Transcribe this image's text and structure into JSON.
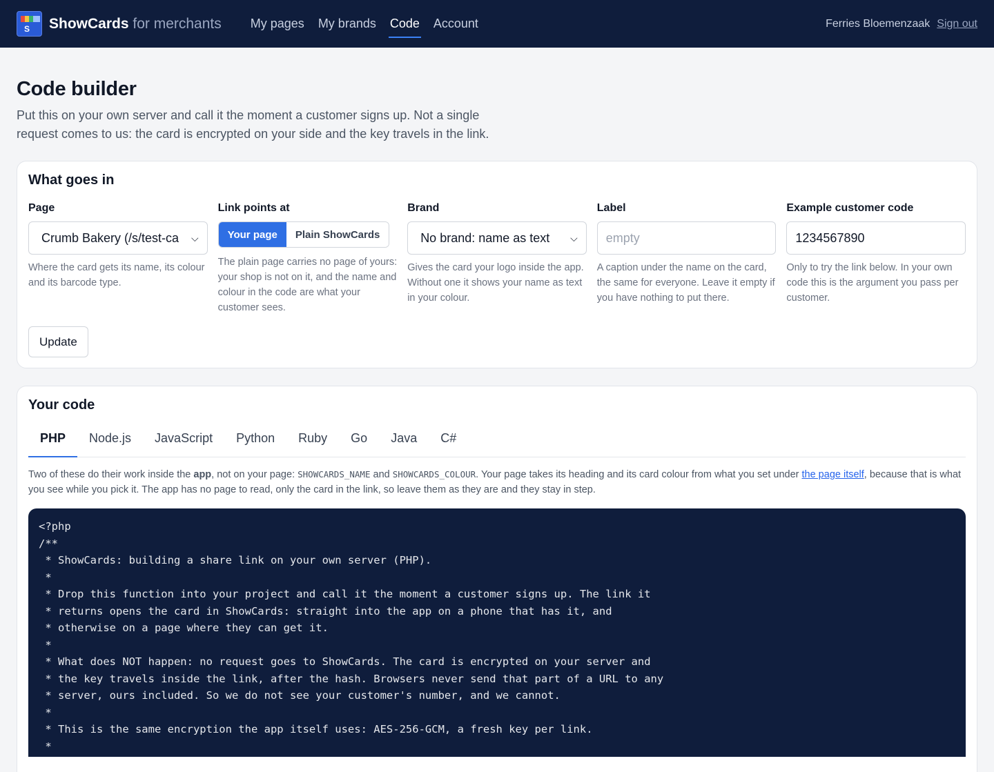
{
  "header": {
    "brand_name": "ShowCards",
    "brand_sub": "for merchants",
    "logo_letter": "S",
    "nav": [
      {
        "label": "My pages",
        "active": false
      },
      {
        "label": "My brands",
        "active": false
      },
      {
        "label": "Code",
        "active": true
      },
      {
        "label": "Account",
        "active": false
      }
    ],
    "user_name": "Ferries Bloemenzaak",
    "sign_out": "Sign out"
  },
  "page": {
    "title": "Code builder",
    "intro": "Put this on your own server and call it the moment a customer signs up. Not a single request comes to us: the card is encrypted on your side and the key travels in the link."
  },
  "inputs_card": {
    "title": "What goes in",
    "page_field": {
      "label": "Page",
      "value": "Crumb Bakery (/s/test-ca",
      "help": "Where the card gets its name, its colour and its barcode type."
    },
    "link_field": {
      "label": "Link points at",
      "options": [
        "Your page",
        "Plain ShowCards"
      ],
      "selected": "Your page",
      "help": "The plain page carries no page of yours: your shop is not on it, and the name and colour in the code are what your customer sees."
    },
    "brand_field": {
      "label": "Brand",
      "value": "No brand: name as text",
      "help": "Gives the card your logo inside the app. Without one it shows your name as text in your colour."
    },
    "label_field": {
      "label": "Label",
      "value": "",
      "placeholder": "empty",
      "help": "A caption under the name on the card, the same for everyone. Leave it empty if you have nothing to put there."
    },
    "customer_field": {
      "label": "Example customer code",
      "value": "1234567890",
      "help": "Only to try the link below. In your own code this is the argument you pass per customer."
    },
    "update_button": "Update"
  },
  "code_card": {
    "title": "Your code",
    "tabs": [
      "PHP",
      "Node.js",
      "JavaScript",
      "Python",
      "Ruby",
      "Go",
      "Java",
      "C#"
    ],
    "active_tab": "PHP",
    "note": {
      "part1": "Two of these do their work inside the ",
      "strong": "app",
      "part2": ", not on your page: ",
      "code1": "SHOWCARDS_NAME",
      "and": " and ",
      "code2": "SHOWCARDS_COLOUR",
      "part3": ". Your page takes its heading and its card colour from what you set under ",
      "link": "the page itself",
      "part4": ", because that is what you see while you pick it. The app has no page to read, only the card in the link, so leave them as they are and they stay in step."
    },
    "code_lines": [
      "<?php",
      "/**",
      " * ShowCards: building a share link on your own server (PHP).",
      " *",
      " * Drop this function into your project and call it the moment a customer signs up. The link it",
      " * returns opens the card in ShowCards: straight into the app on a phone that has it, and",
      " * otherwise on a page where they can get it.",
      " *",
      " * What does NOT happen: no request goes to ShowCards. The card is encrypted on your server and",
      " * the key travels inside the link, after the hash. Browsers never send that part of a URL to any",
      " * server, ours included. So we do not see your customer's number, and we cannot.",
      " *",
      " * This is the same encryption the app itself uses: AES-256-GCM, a fresh key per link.",
      " *"
    ]
  }
}
